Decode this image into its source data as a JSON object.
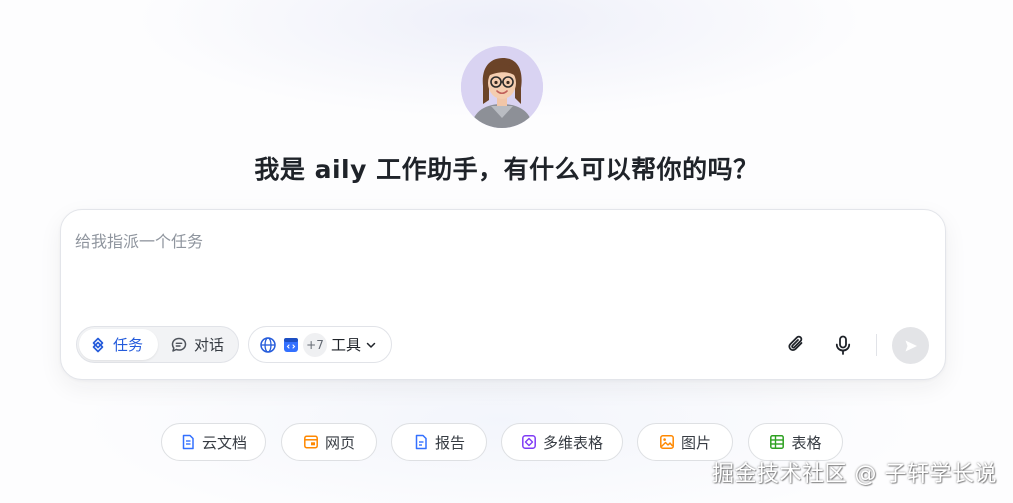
{
  "headline": "我是 aily 工作助手，有什么可以帮你的吗？",
  "composer": {
    "placeholder": "给我指派一个任务",
    "value": ""
  },
  "modes": {
    "task_label": "任务",
    "chat_label": "对话",
    "selected": "任务"
  },
  "tools": {
    "more_count": "+7",
    "label": "工具"
  },
  "suggestions": [
    {
      "label": "云文档",
      "icon": "doc-icon",
      "color": "#3370ff"
    },
    {
      "label": "网页",
      "icon": "webpage-icon",
      "color": "#ff8800"
    },
    {
      "label": "报告",
      "icon": "report-icon",
      "color": "#3370ff"
    },
    {
      "label": "多维表格",
      "icon": "bitable-icon",
      "color": "#7f3bf5"
    },
    {
      "label": "图片",
      "icon": "image-icon",
      "color": "#ff8800"
    },
    {
      "label": "表格",
      "icon": "sheet-icon",
      "color": "#2ea121"
    }
  ],
  "watermark": "掘金技术社区 @ 子轩学长说",
  "colors": {
    "accent": "#245bdb",
    "avatar_bg": "#d9d3f2",
    "send_disabled": "#e3e4e7"
  }
}
